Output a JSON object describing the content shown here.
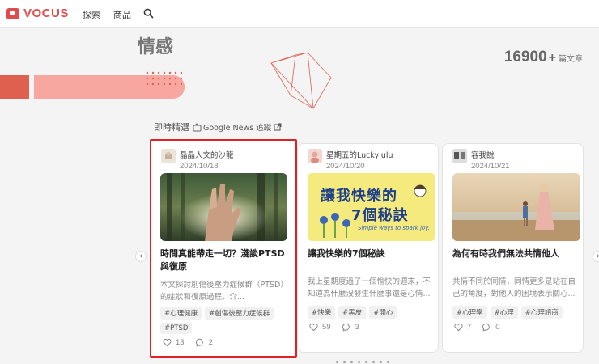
{
  "header": {
    "logo_text": "VOCUS",
    "nav": [
      "探索",
      "商品"
    ],
    "search_icon": "search-icon"
  },
  "hero": {
    "title": "情感",
    "count": "16900",
    "plus": "+",
    "unit": "篇文章",
    "colors": {
      "accent_red": "#e0604f",
      "accent_pink": "#f7a79f"
    }
  },
  "section": {
    "title": "即時精選",
    "gnews_label": "Google News 追蹤",
    "icons": [
      "google-news-icon",
      "external-link-icon"
    ]
  },
  "cards": [
    {
      "author": "晶晶人文的沙龍",
      "date": "2024/10/18",
      "title": "時間真能帶走一切？淺談PTSD與復原",
      "excerpt": "本文探討創傷後壓力症候群（PTSD）的症狀和復原過程。介...",
      "tags": [
        "#心理健康",
        "#創傷後壓力症候群",
        "#PTSD"
      ],
      "likes": "13",
      "comments": "2"
    },
    {
      "author": "星期五的Luckylulu",
      "date": "2024/10/20",
      "title": "讓我快樂的7個秘訣",
      "excerpt": "我上星期度過了一個愉快的週末，不知道為什麼沒發生什麼事還是心情...",
      "tags": [
        "#快樂",
        "#黑皮",
        "#開心"
      ],
      "likes": "59",
      "comments": "3",
      "thumb_text_1": "讓我快樂的",
      "thumb_text_2": "7個秘訣",
      "thumb_sub": "Simple ways to spark joy."
    },
    {
      "author": "容我說",
      "date": "2024/10/21",
      "title": "為何有時我們無法共情他人",
      "excerpt": "共情不同於同情，同情更多是站在自己的角度，對他人的困境表示關心...",
      "tags": [
        "#心理學",
        "#心理",
        "#心理諮商"
      ],
      "likes": "7",
      "comments": "0"
    }
  ],
  "highlight_color": "#e11f26"
}
